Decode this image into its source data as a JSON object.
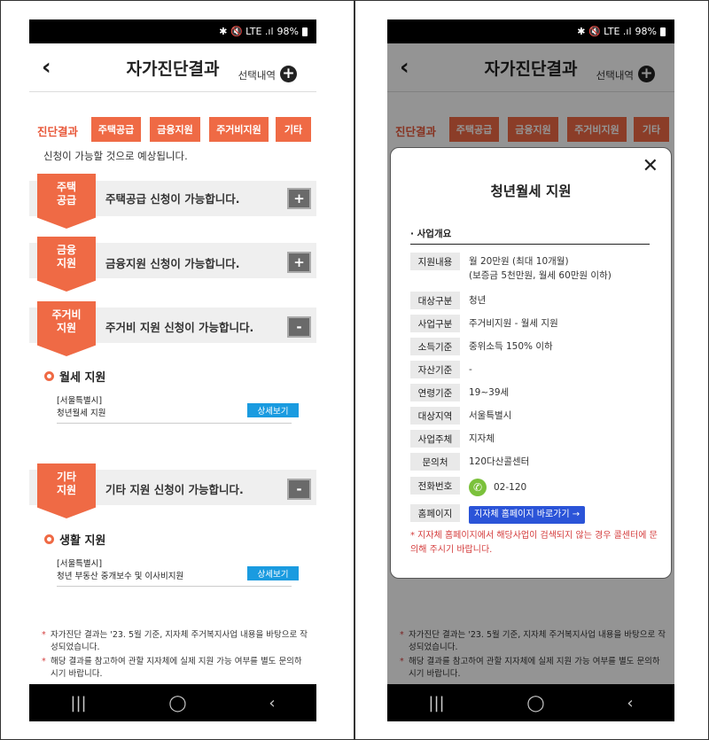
{
  "status": {
    "icons": "✱ 🔇 LTE .ıl",
    "battery": "98%"
  },
  "header": {
    "title": "자가진단결과",
    "selected_label": "선택내역"
  },
  "tabs": {
    "label": "진단결과",
    "items": [
      "주택공급",
      "금융지원",
      "주거비지원",
      "기타"
    ]
  },
  "summary": "신청이 가능할 것으로 예상됩니다.",
  "sections": [
    {
      "ribbon": "주택\n공급",
      "text": "주택공급 신청이 가능합니다.",
      "toggle": "+"
    },
    {
      "ribbon": "금융\n지원",
      "text": "금융지원 신청이 가능합니다.",
      "toggle": "+"
    },
    {
      "ribbon": "주거비\n지원",
      "text": "주거비 지원 신청이 가능합니다.",
      "toggle": "-"
    },
    {
      "ribbon": "기타\n지원",
      "text": "기타 지원 신청이 가능합니다.",
      "toggle": "-"
    }
  ],
  "sub1": {
    "title": "월세 지원",
    "item_region": "[서울특별시]",
    "item_name": "청년월세 지원",
    "detail": "상세보기"
  },
  "sub2": {
    "title": "생활 지원",
    "item_region": "[서울특별시]",
    "item_name": "청년 부동산 중개보수 및 이사비지원",
    "detail": "상세보기"
  },
  "notes": [
    "자가진단 결과는 '23. 5월 기준, 지자체 주거복지사업 내용을 바탕으로 작성되었습니다.",
    "해당 결과를 참고하여 관할 지자체에 실제 지원 가능 여부를 별도 문의하시기 바랍니다."
  ],
  "modal": {
    "title": "청년월세 지원",
    "overview": "· 사업개요",
    "rows": [
      {
        "label": "지원내용",
        "value": "월 20만원 (최대 10개월)",
        "value2": "(보증금 5천만원, 월세 60만원 이하)"
      },
      {
        "label": "대상구분",
        "value": "청년"
      },
      {
        "label": "사업구분",
        "value": "주거비지원 - 월세 지원"
      },
      {
        "label": "소득기준",
        "value": "중위소득 150% 이하"
      },
      {
        "label": "자산기준",
        "value": "-"
      },
      {
        "label": "연령기준",
        "value": "19~39세"
      },
      {
        "label": "대상지역",
        "value": "서울특별시"
      },
      {
        "label": "사업주체",
        "value": "지자체"
      },
      {
        "label": "문의처",
        "value": "120다산콜센터"
      },
      {
        "label": "전화번호",
        "value": "02-120"
      },
      {
        "label": "홈페이지",
        "value": "지자체 홈페이지 바로가기 →"
      }
    ],
    "note": "* 지자체 홈페이지에서 해당사업이 검색되지 않는 경우 콜센터에 문의해 주시기 바랍니다."
  },
  "colors": {
    "accent": "#ef6a45",
    "button_blue": "#1a9be0",
    "link_blue": "#2b54d8",
    "note_red": "#d43d3d"
  }
}
